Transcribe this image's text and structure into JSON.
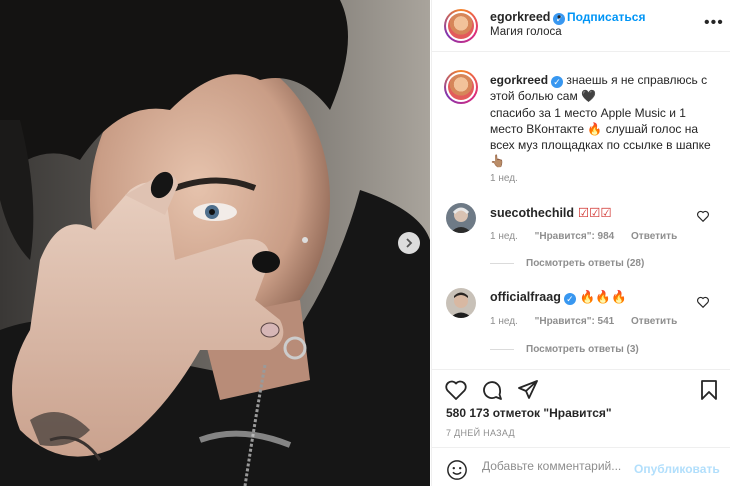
{
  "post": {
    "author": "egorkreed",
    "follow_label": "Подписаться",
    "dot": "•",
    "subtitle": "Магия голоса",
    "more": "•••"
  },
  "caption": {
    "username": "egorkreed",
    "text_1": "знаешь я не справлюсь с этой болью сам",
    "emoji_1": "🖤",
    "text_2": "спасибо за 1 место Apple Music и 1 место ВКонтакте",
    "emoji_2": "🔥",
    "text_3": "слушай голос на всех муз площадках по ссылке в шапке",
    "emoji_3": "👆🏽",
    "time": "1 нед."
  },
  "comments": [
    {
      "username": "suecothechild",
      "text": "☑☑☑",
      "time": "1 нед.",
      "likes": "\"Нравится\": 984",
      "reply": "Ответить",
      "view_replies": "Посмотреть ответы (28)"
    },
    {
      "username": "officialfraag",
      "text": "🔥🔥🔥",
      "time": "1 нед.",
      "likes": "\"Нравится\": 541",
      "reply": "Ответить",
      "view_replies": "Посмотреть ответы (3)"
    }
  ],
  "likes_line": "580 173 отметок \"Нравится\"",
  "date": "7 ДНЕЙ НАЗАД",
  "add_comment": {
    "placeholder": "Добавьте комментарий...",
    "publish": "Опубликовать"
  },
  "icons": {
    "carousel": "chevron-right-icon",
    "like": "heart-icon",
    "comment": "comment-bubble-icon",
    "share": "paper-plane-icon",
    "save": "bookmark-icon",
    "emoji": "smiley-icon"
  },
  "colors": {
    "accent": "#0095f6",
    "verified": "#3897f0",
    "muted": "#8e8e8e",
    "publish_disabled": "#b2dffc"
  }
}
